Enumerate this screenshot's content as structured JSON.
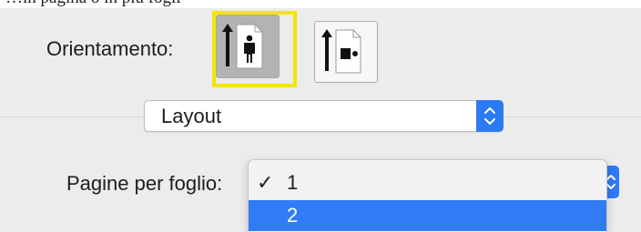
{
  "header_text": "…in pagina o in più fogli",
  "orientation": {
    "label": "Orientamento:",
    "selected": "portrait",
    "options": [
      {
        "id": "portrait",
        "icon": "portrait-person-icon"
      },
      {
        "id": "landscape",
        "icon": "landscape-person-icon"
      }
    ],
    "highlight_color": "#f3e600"
  },
  "section_popup": {
    "value": "Layout",
    "icon": "stepper-updown-icon"
  },
  "pages_per_sheet": {
    "label": "Pagine per foglio:",
    "menu": {
      "check_glyph": "✓",
      "items": [
        {
          "label": "1",
          "checked": true,
          "highlighted": false
        },
        {
          "label": "2",
          "checked": false,
          "highlighted": true
        }
      ]
    }
  },
  "colors": {
    "accent": "#2d7af6",
    "window_bg": "#ececec"
  }
}
